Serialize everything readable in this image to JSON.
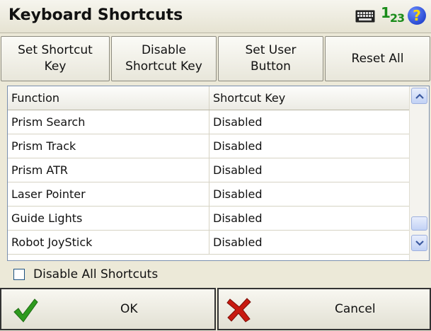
{
  "window": {
    "title": "Keyboard Shortcuts",
    "icons": {
      "keyboard": "keyboard-icon",
      "input_mode": "123-input-icon",
      "input_mode_text": "1",
      "input_mode_sub": "23",
      "help": "help-icon",
      "help_text": "?"
    }
  },
  "toolbar": {
    "buttons": [
      {
        "label": "Set Shortcut\nKey"
      },
      {
        "label": "Disable\nShortcut Key"
      },
      {
        "label": "Set User\nButton"
      },
      {
        "label": "Reset All"
      }
    ]
  },
  "table": {
    "columns": [
      "Function",
      "Shortcut Key"
    ],
    "rows": [
      {
        "function": "Prism Search",
        "shortcut": "Disabled"
      },
      {
        "function": "Prism Track",
        "shortcut": "Disabled"
      },
      {
        "function": "Prism ATR",
        "shortcut": "Disabled"
      },
      {
        "function": "Laser Pointer",
        "shortcut": "Disabled"
      },
      {
        "function": "Guide Lights",
        "shortcut": "Disabled"
      },
      {
        "function": "Robot JoyStick",
        "shortcut": "Disabled"
      }
    ]
  },
  "options": {
    "disable_all_label": "Disable All Shortcuts",
    "disable_all_checked": false
  },
  "actions": {
    "ok_label": "OK",
    "cancel_label": "Cancel"
  },
  "colors": {
    "ok_check": "#2e9a1e",
    "cancel_x": "#c81a10",
    "accent_blue": "#1030c0"
  }
}
